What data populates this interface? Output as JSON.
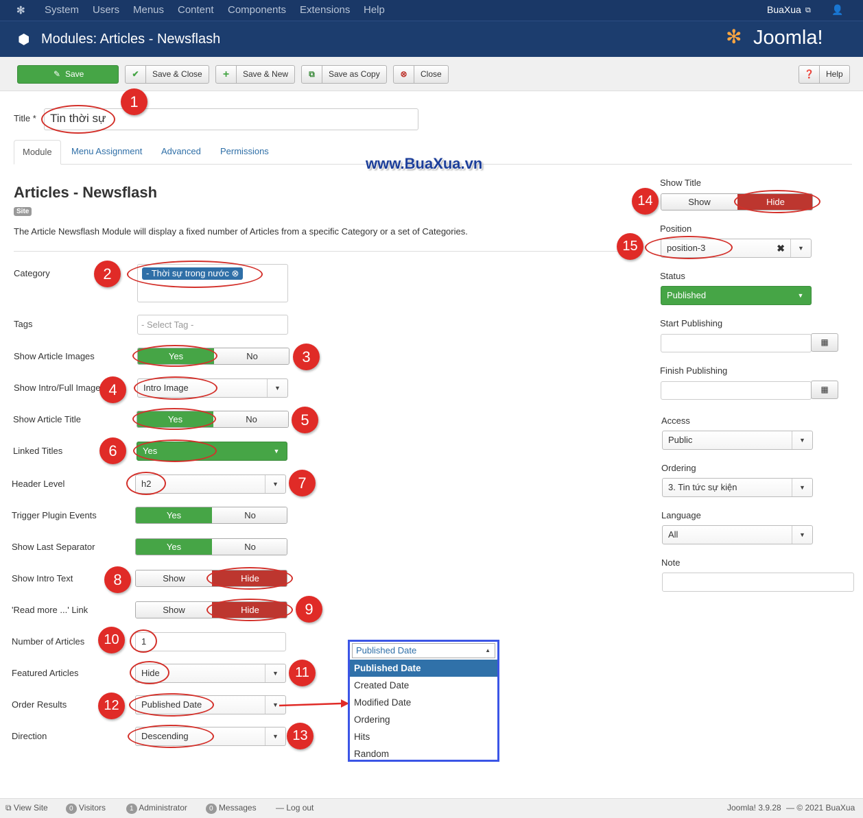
{
  "topnav": {
    "menu": [
      "System",
      "Users",
      "Menus",
      "Content",
      "Components",
      "Extensions",
      "Help"
    ],
    "user": "BuaXua"
  },
  "header": {
    "title": "Modules: Articles - Newsflash",
    "brand": "Joomla!"
  },
  "toolbar": {
    "save": "Save",
    "save_close": "Save & Close",
    "save_new": "Save & New",
    "save_copy": "Save as Copy",
    "close": "Close",
    "help": "Help"
  },
  "title_field": {
    "label": "Title *",
    "value": "Tin thời sự"
  },
  "tabs": [
    "Module",
    "Menu Assignment",
    "Advanced",
    "Permissions"
  ],
  "watermark": "www.BuaXua.vn",
  "module": {
    "heading": "Articles - Newsflash",
    "badge": "Site",
    "description": "The Article Newsflash Module will display a fixed number of Articles from a specific Category or a set of Categories."
  },
  "fields": {
    "category": {
      "label": "Category",
      "tag": "- Thời sự trong nước"
    },
    "tags": {
      "label": "Tags",
      "placeholder": "- Select Tag -"
    },
    "show_images": {
      "label": "Show Article Images",
      "yes": "Yes",
      "no": "No"
    },
    "intro_full": {
      "label": "Show Intro/Full Image",
      "value": "Intro Image"
    },
    "show_title": {
      "label": "Show Article Title",
      "yes": "Yes",
      "no": "No"
    },
    "linked_titles": {
      "label": "Linked Titles",
      "value": "Yes"
    },
    "header_level": {
      "label": "Header Level",
      "value": "h2"
    },
    "trigger": {
      "label": "Trigger Plugin Events",
      "yes": "Yes",
      "no": "No"
    },
    "last_sep": {
      "label": "Show Last Separator",
      "yes": "Yes",
      "no": "No"
    },
    "intro_text": {
      "label": "Show Intro Text",
      "show": "Show",
      "hide": "Hide"
    },
    "readmore": {
      "label": "'Read more ...' Link",
      "show": "Show",
      "hide": "Hide"
    },
    "num_articles": {
      "label": "Number of Articles",
      "value": "1"
    },
    "featured": {
      "label": "Featured Articles",
      "value": "Hide"
    },
    "order": {
      "label": "Order Results",
      "value": "Published Date"
    },
    "direction": {
      "label": "Direction",
      "value": "Descending"
    }
  },
  "popup": {
    "current": "Published Date",
    "options": [
      "Published Date",
      "Created Date",
      "Modified Date",
      "Ordering",
      "Hits",
      "Random"
    ]
  },
  "sidebar": {
    "show_title": {
      "label": "Show Title",
      "show": "Show",
      "hide": "Hide"
    },
    "position": {
      "label": "Position",
      "value": "position-3"
    },
    "status": {
      "label": "Status",
      "value": "Published"
    },
    "start_pub": {
      "label": "Start Publishing"
    },
    "finish_pub": {
      "label": "Finish Publishing"
    },
    "access": {
      "label": "Access",
      "value": "Public"
    },
    "ordering": {
      "label": "Ordering",
      "value": "3. Tin tức sự kiện"
    },
    "language": {
      "label": "Language",
      "value": "All"
    },
    "note": {
      "label": "Note"
    }
  },
  "markers": [
    "1",
    "2",
    "3",
    "4",
    "5",
    "6",
    "7",
    "8",
    "9",
    "10",
    "11",
    "12",
    "13",
    "14",
    "15"
  ],
  "footer": {
    "view_site": "View Site",
    "visitors_count": "0",
    "visitors": "Visitors",
    "admin_count": "1",
    "admin": "Administrator",
    "messages_count": "0",
    "messages": "Messages",
    "logout": "Log out",
    "version": "Joomla! 3.9.28",
    "copyright": "— © 2021 BuaXua"
  }
}
